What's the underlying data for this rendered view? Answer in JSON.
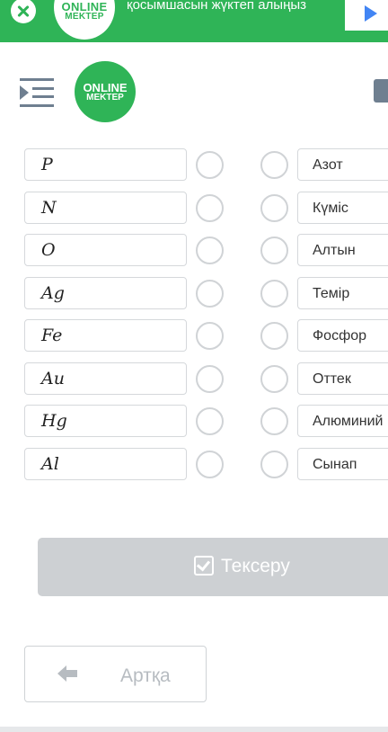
{
  "banner": {
    "logo_line1": "ONLINE",
    "logo_line2": "MEKTEP",
    "text": "қосымшасын жүктеп алыңыз"
  },
  "header": {
    "logo_line1": "ONLINE",
    "logo_line2": "MEKTEP"
  },
  "matching": {
    "left": [
      "P",
      "N",
      "O",
      "Ag",
      "Fe",
      "Au",
      "Hg",
      "Al"
    ],
    "right": [
      "Азот",
      "Күміс",
      "Алтын",
      "Темір",
      "Фосфор",
      "Оттек",
      "Алюминий",
      "Сынап"
    ]
  },
  "actions": {
    "check_label": "Тексеру",
    "back_label": "Артқа"
  },
  "colors": {
    "brand_green": "#2fb457",
    "disabled_button": "#cdd0d3"
  }
}
